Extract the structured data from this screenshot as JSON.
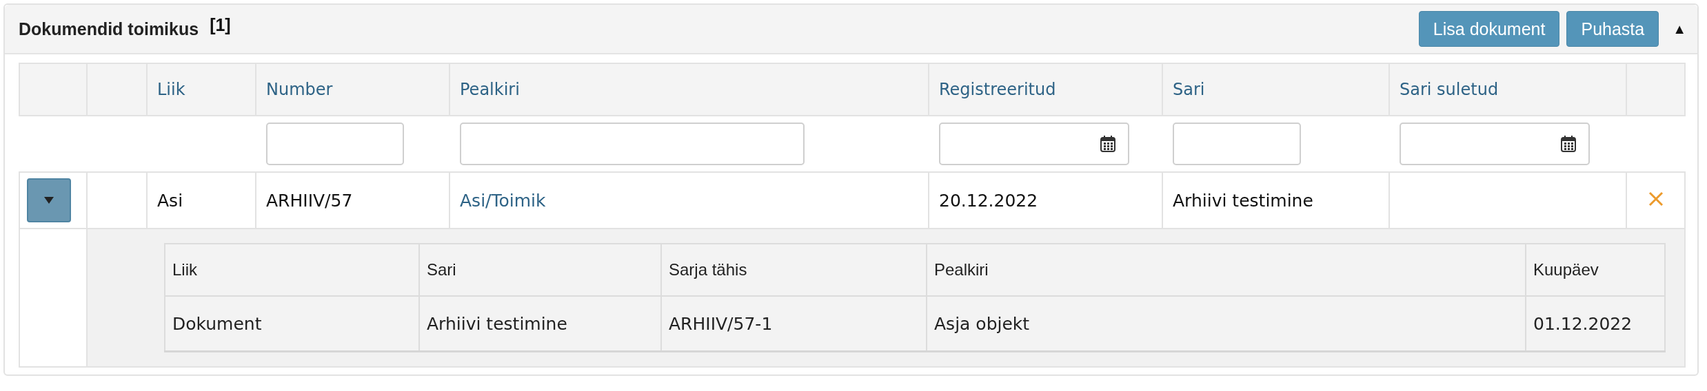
{
  "panel": {
    "title": "Dokumendid toimikus",
    "count": "[1]",
    "buttons": [
      "Lisa dokument",
      "Puhasta"
    ],
    "collapse_toggle": "▲",
    "collapsed": false
  },
  "table": {
    "columns": [
      "Liik",
      "Number",
      "Pealkiri",
      "Registreeritud",
      "Sari",
      "Sari suletud"
    ],
    "filters": [
      {
        "kind": "none"
      },
      {
        "kind": "text"
      },
      {
        "kind": "text"
      },
      {
        "kind": "date"
      },
      {
        "kind": "text"
      },
      {
        "kind": "date"
      }
    ],
    "rows": [
      {
        "expanded": true,
        "cells": [
          {
            "kind": "plain",
            "text": "Asi"
          },
          {
            "kind": "plain",
            "text": "ARHIIV/57"
          },
          {
            "kind": "link",
            "text": "Asi/Toimik"
          },
          {
            "kind": "plain",
            "text": "20.12.2022"
          },
          {
            "kind": "plain",
            "text": "Arhiivi testimine"
          }
        ],
        "details": {
          "columns": [
            "Liik",
            "Sari",
            "Sarja tähis",
            "Pealkiri",
            "Kuupäev"
          ],
          "rows": [
            [
              "Dokument",
              "Arhiivi testimine",
              "ARHIIV/57-1",
              "Asja objekt",
              "01.12.2022"
            ]
          ]
        }
      }
    ]
  }
}
